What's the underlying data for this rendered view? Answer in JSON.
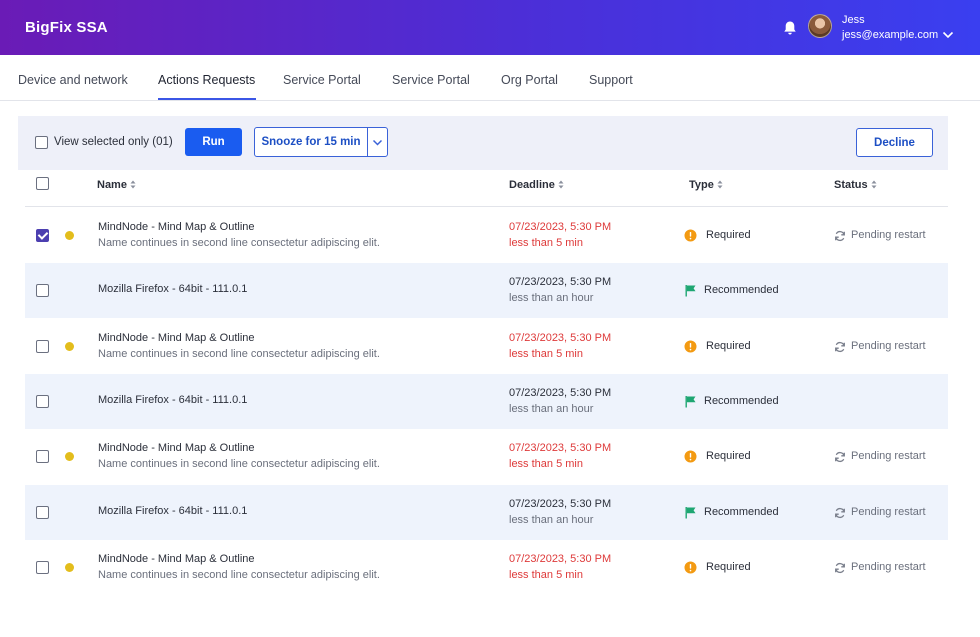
{
  "header": {
    "brand": "BigFix SSA",
    "user_name": "Jess",
    "user_email": "jess@example.com"
  },
  "tabs": [
    {
      "label": "Device and network"
    },
    {
      "label": "Actions Requests"
    },
    {
      "label": "Service Portal"
    },
    {
      "label": "Service Portal"
    },
    {
      "label": "Org Portal"
    },
    {
      "label": "Support"
    }
  ],
  "active_tab": "Actions Requests",
  "toolbar": {
    "view_selected_label": "View selected only (01)",
    "run_label": "Run",
    "snooze_label": "Snooze for 15 min",
    "decline_label": "Decline"
  },
  "table": {
    "columns": [
      "Name",
      "Deadline",
      "Type",
      "Status"
    ],
    "rows": [
      {
        "checked": true,
        "dot": true,
        "name": "MindNode - Mind Map & Outline",
        "desc": "Name continues in second line consectetur adipiscing elit.",
        "date": "07/23/2023, 5:30 PM",
        "sub": "less than 5 min",
        "urgent": true,
        "type": "Required",
        "type_icon": "warning-icon",
        "status": "Pending restart"
      },
      {
        "checked": false,
        "dot": false,
        "name": "Mozilla Firefox - 64bit - 111.0.1",
        "desc": "",
        "date": "07/23/2023, 5:30 PM",
        "sub": "less than an hour",
        "urgent": false,
        "type": "Recommended",
        "type_icon": "flag-icon",
        "status": ""
      },
      {
        "checked": false,
        "dot": true,
        "name": "MindNode - Mind Map & Outline",
        "desc": "Name continues in second line consectetur adipiscing elit.",
        "date": "07/23/2023, 5:30 PM",
        "sub": "less than 5 min",
        "urgent": true,
        "type": "Required",
        "type_icon": "warning-icon",
        "status": "Pending restart"
      },
      {
        "checked": false,
        "dot": false,
        "name": "Mozilla Firefox - 64bit - 111.0.1",
        "desc": "",
        "date": "07/23/2023, 5:30 PM",
        "sub": "less than an hour",
        "urgent": false,
        "type": "Recommended",
        "type_icon": "flag-icon",
        "status": ""
      },
      {
        "checked": false,
        "dot": true,
        "name": "MindNode - Mind Map & Outline",
        "desc": "Name continues in second line consectetur adipiscing elit.",
        "date": "07/23/2023, 5:30 PM",
        "sub": "less than 5 min",
        "urgent": true,
        "type": "Required",
        "type_icon": "warning-icon",
        "status": "Pending restart"
      },
      {
        "checked": false,
        "dot": false,
        "name": "Mozilla Firefox - 64bit - 111.0.1",
        "desc": "",
        "date": "07/23/2023, 5:30 PM",
        "sub": "less than an hour",
        "urgent": false,
        "type": "Recommended",
        "type_icon": "flag-icon",
        "status": "Pending restart"
      },
      {
        "checked": false,
        "dot": true,
        "name": "MindNode - Mind Map & Outline",
        "desc": "Name continues in second line consectetur adipiscing elit.",
        "date": "07/23/2023, 5:30 PM",
        "sub": "less than 5 min",
        "urgent": true,
        "type": "Required",
        "type_icon": "warning-icon",
        "status": "Pending restart"
      }
    ]
  },
  "colors": {
    "accent": "#1a5cf0",
    "header_start": "#6a1bb6",
    "header_end": "#3a3ff0",
    "urgent": "#de3a3a",
    "required_icon": "#f39a12",
    "recommended_icon": "#1ea672",
    "dot": "#e3bd1c"
  }
}
